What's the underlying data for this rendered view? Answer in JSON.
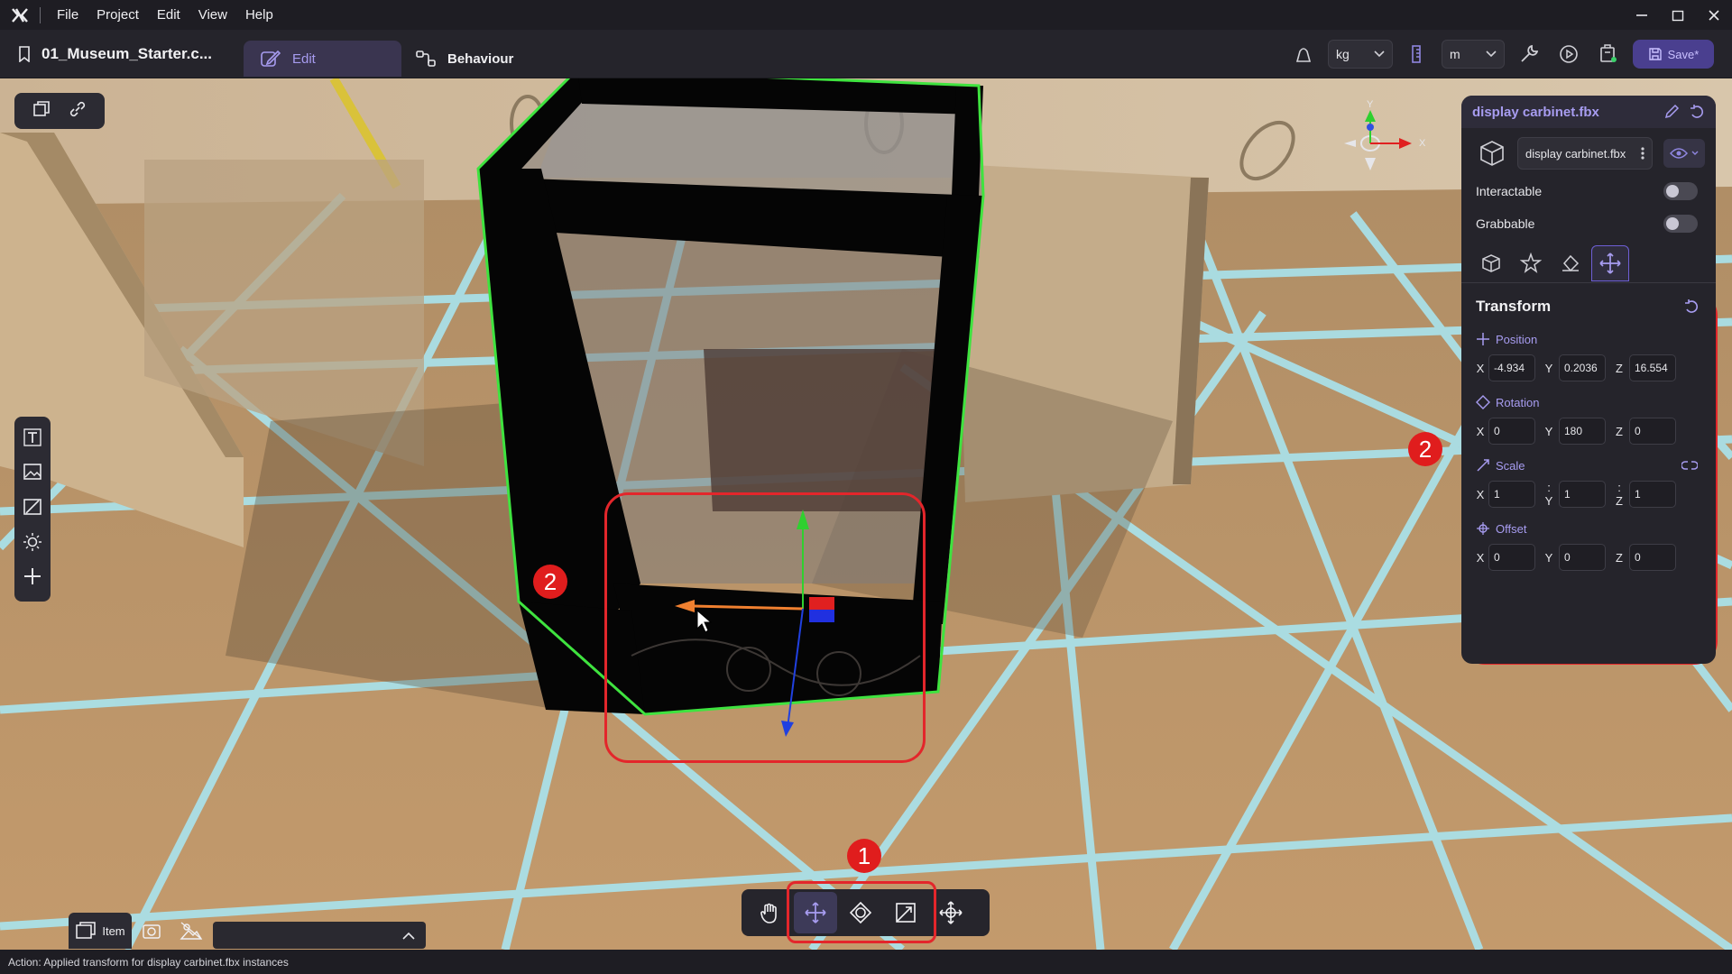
{
  "menubar": {
    "items": [
      "File",
      "Project",
      "Edit",
      "View",
      "Help"
    ]
  },
  "toolbar": {
    "project_name": "01_Museum_Starter.c...",
    "tabs": [
      {
        "label": "Edit",
        "active": true
      },
      {
        "label": "Behaviour",
        "active": false
      }
    ],
    "mass_unit": "kg",
    "length_unit": "m",
    "save_label": "Save*"
  },
  "inspector": {
    "title": "display carbinet.fbx",
    "asset_name": "display carbinet.fbx",
    "toggles": [
      {
        "label": "Interactable",
        "on": false
      },
      {
        "label": "Grabbable",
        "on": false
      }
    ],
    "tab_icons": [
      "cube-icon",
      "star-icon",
      "paint-icon",
      "move-icon"
    ],
    "active_tab": "move-icon",
    "transform": {
      "title": "Transform",
      "position": {
        "label": "Position",
        "x": "-4.934",
        "y": "0.2036",
        "z": "16.554"
      },
      "rotation": {
        "label": "Rotation",
        "x": "0",
        "y": "180",
        "z": "0"
      },
      "scale": {
        "label": "Scale",
        "x": "1",
        "y": "1",
        "z": "1"
      },
      "offset": {
        "label": "Offset",
        "x": "0",
        "y": "0",
        "z": "0"
      }
    }
  },
  "viewport": {
    "axis_labels": {
      "y": "Y",
      "x": "X"
    },
    "callouts": {
      "toolbar": "1",
      "gizmo": "2",
      "transform_panel": "2"
    }
  },
  "bottom_toolbar": {
    "tools": [
      "hand-icon",
      "move-icon",
      "rotate-icon",
      "scale-icon",
      "transform-icon"
    ],
    "active_tool": "move-icon"
  },
  "bottom_left": {
    "tab_label": "Item"
  },
  "status": {
    "text": "Action: Applied transform for display carbinet.fbx instances"
  },
  "colors": {
    "accent": "#a79cf0",
    "callout": "#e01d1d",
    "selection_outline": "#3fe33f"
  }
}
